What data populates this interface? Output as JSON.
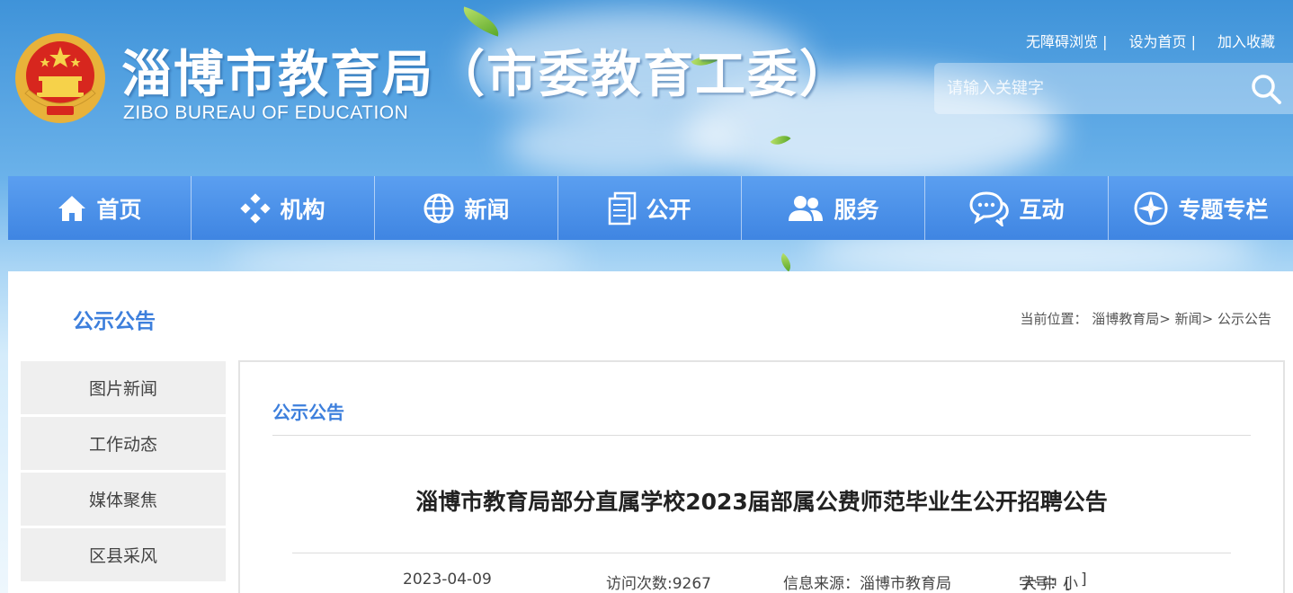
{
  "header": {
    "title": "淄博市教育局（市委教育工委）",
    "subtitle": "ZIBO BUREAU OF EDUCATION",
    "toplinks": [
      {
        "label": "无障碍浏览",
        "sep": "|"
      },
      {
        "label": "设为首页",
        "sep": "|"
      },
      {
        "label": "加入收藏",
        "sep": ""
      }
    ],
    "search": {
      "placeholder": "请输入关键字",
      "icon": "search-icon"
    }
  },
  "nav": {
    "items": [
      {
        "label": "首页",
        "icon": "home-icon"
      },
      {
        "label": "机构",
        "icon": "org-icon"
      },
      {
        "label": "新闻",
        "icon": "globe-icon"
      },
      {
        "label": "公开",
        "icon": "document-icon"
      },
      {
        "label": "服务",
        "icon": "users-icon"
      },
      {
        "label": "互动",
        "icon": "chat-icon"
      },
      {
        "label": "专题专栏",
        "icon": "compass-icon"
      }
    ]
  },
  "main": {
    "section_title": "公示公告",
    "breadcrumb": {
      "prefix": "当前位置：",
      "items": [
        "淄博教育局>",
        "新闻>",
        "公示公告"
      ]
    }
  },
  "sidebar": {
    "items": [
      {
        "label": "图片新闻"
      },
      {
        "label": "工作动态"
      },
      {
        "label": "媒体聚焦"
      },
      {
        "label": "区县采风"
      }
    ]
  },
  "article": {
    "category": "公示公告",
    "title": "淄博市教育局部分直属学校2023届部属公费师范毕业生公开招聘公告",
    "date": "2023-04-09",
    "views": "访问次数:9267",
    "source": "信息来源：淄博市教育局",
    "font_size": {
      "label": "字号：[",
      "large": "大",
      "medium": "中",
      "small": "小",
      "end": "]"
    }
  },
  "colors": {
    "accent": "#3d7fdc",
    "nav_bg": "#4a8fe8"
  }
}
